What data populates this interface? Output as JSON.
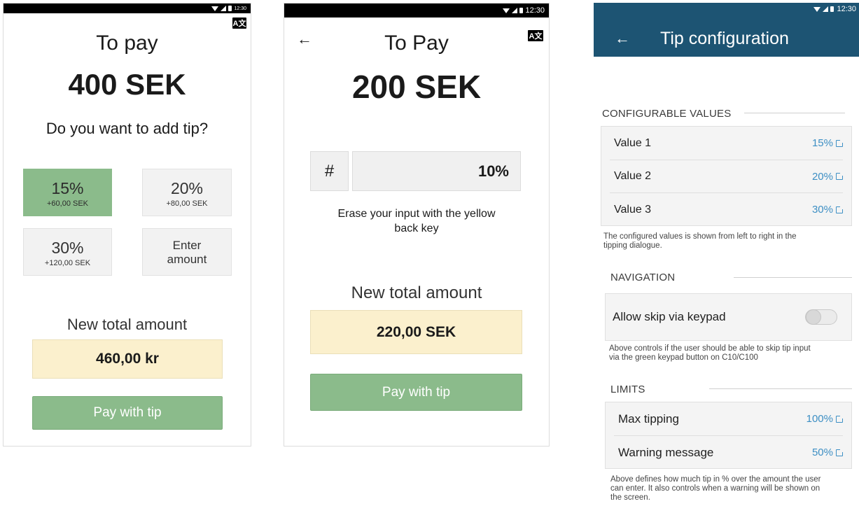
{
  "status": {
    "time": "12:30"
  },
  "lang_button": "A文",
  "screen1": {
    "title": "To pay",
    "amount": "400 SEK",
    "question": "Do you want to add tip?",
    "options": [
      {
        "pct": "15%",
        "sub": "+60,00 SEK",
        "selected": true
      },
      {
        "pct": "20%",
        "sub": "+80,00 SEK",
        "selected": false
      },
      {
        "pct": "30%",
        "sub": "+120,00 SEK",
        "selected": false
      }
    ],
    "enter_amount_line1": "Enter",
    "enter_amount_line2": "amount",
    "total_label": "New total amount",
    "total_value": "460,00 kr",
    "pay_button": "Pay with tip"
  },
  "screen2": {
    "back_icon": "←",
    "title": "To Pay",
    "amount": "200 SEK",
    "hash_label": "#",
    "input_value": "10%",
    "hint_line1": "Erase your input with the yellow",
    "hint_line2": "back key",
    "total_label": "New total amount",
    "total_value": "220,00 SEK",
    "pay_button": "Pay with tip"
  },
  "screen3": {
    "back_icon": "←",
    "title": "Tip configuration",
    "sections": {
      "configurable": {
        "title": "CONFIGURABLE VALUES",
        "rows": [
          {
            "label": "Value 1",
            "value": "15%"
          },
          {
            "label": "Value 2",
            "value": "20%"
          },
          {
            "label": "Value 3",
            "value": "30%"
          }
        ],
        "help_line1": "The configured values is shown from left to right in the",
        "help_line2": "tipping dialogue."
      },
      "navigation": {
        "title": "NAVIGATION",
        "row_label": "Allow skip via keypad",
        "toggle_on": false,
        "help_line1": "Above controls if the user should be able to skip tip input",
        "help_line2": "via the green keypad button on C10/C100"
      },
      "limits": {
        "title": "LIMITS",
        "rows": [
          {
            "label": "Max tipping",
            "value": "100%"
          },
          {
            "label": "Warning message",
            "value": "50%"
          }
        ],
        "help_line1": "Above defines how much tip in % over the amount the user",
        "help_line2": "can enter. It also controls when a warning will be shown on",
        "help_line3": "the screen."
      }
    }
  },
  "colors": {
    "accent_green": "#8bbb8b",
    "total_yellow": "#fbf0cd",
    "appbar_blue": "#1d5473",
    "link_blue": "#3d8fc4"
  }
}
